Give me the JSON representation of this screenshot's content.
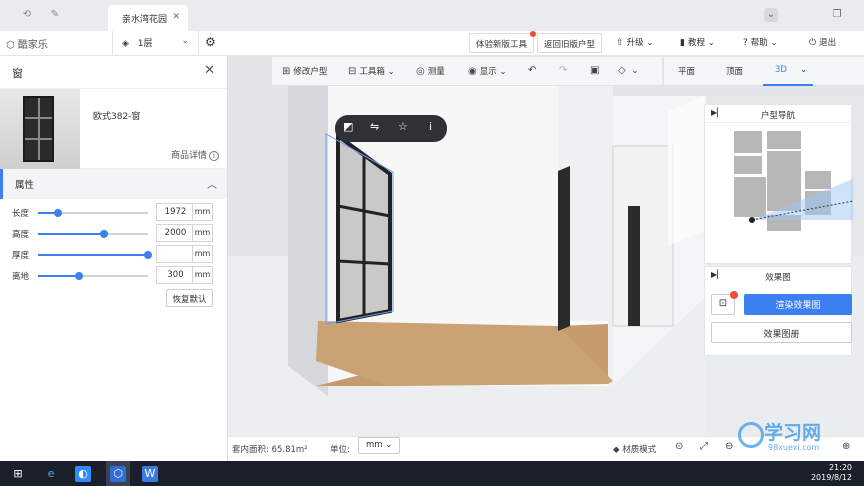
{
  "tabbar": {
    "doc_tab": "亲水湾花园"
  },
  "appbar": {
    "logo": "酷家乐",
    "floor": "1层",
    "new_tools": "体验新版工具",
    "old_plan": "返回旧版户型",
    "upgrade": "升级",
    "tutorial": "教程",
    "help": "帮助",
    "logout": "退出"
  },
  "leftpanel": {
    "title": "窗",
    "product_name": "欧式382-窗",
    "product_detail": "商品详情",
    "section": "属性",
    "reset": "恢复默认",
    "params": [
      {
        "label": "长度",
        "value": "1972",
        "unit": "mm",
        "level": 0.18
      },
      {
        "label": "高度",
        "value": "2000",
        "unit": "mm",
        "level": 0.6
      },
      {
        "label": "厚度",
        "value": "",
        "unit": "mm",
        "level": 1.0
      },
      {
        "label": "离地",
        "value": "300",
        "unit": "mm",
        "level": 0.37
      }
    ]
  },
  "toolbar": {
    "edit_plan": "修改户型",
    "toolbox": "工具箱",
    "measure": "测量",
    "display": "显示"
  },
  "viewtabs": {
    "plan": "平面",
    "top": "顶面",
    "threed": "3D"
  },
  "nav_panel": {
    "title": "户型导航"
  },
  "render_panel": {
    "title": "效果图",
    "render_btn": "渲染效果图",
    "album_btn": "效果图册"
  },
  "statusbar": {
    "area": "套内面积: 65.81m²",
    "unit_label": "单位:",
    "unit_value": "mm",
    "material_mode": "材质模式"
  },
  "taskbar": {
    "time": "21:20",
    "date": "2019/8/12"
  },
  "watermark": {
    "text": "学习网",
    "url": "98xuexi.com"
  },
  "colors": {
    "accent": "#3b7ff0",
    "taskbar": "#1b1f29"
  }
}
